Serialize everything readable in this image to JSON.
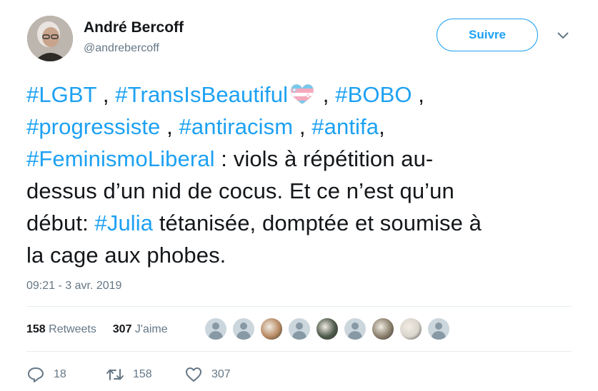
{
  "user": {
    "name": "André Bercoff",
    "handle": "@andrebercoff",
    "follow_label": "Suivre"
  },
  "tweet": {
    "lines": [
      [
        {
          "t": "#LGBT",
          "tag": true
        },
        {
          "t": " , "
        },
        {
          "t": "#TransIsBeautiful",
          "tag": true
        },
        {
          "flag": "transgender-heart-flag"
        },
        {
          "t": " , "
        },
        {
          "t": "#BOBO",
          "tag": true
        },
        {
          "t": " ,"
        }
      ],
      [
        {
          "t": "#progressiste",
          "tag": true
        },
        {
          "t": " , "
        },
        {
          "t": "#antiracism",
          "tag": true
        },
        {
          "t": " , "
        },
        {
          "t": "#antifa",
          "tag": true
        },
        {
          "t": ","
        }
      ],
      [
        {
          "t": "#FeminismoLiberal",
          "tag": true
        },
        {
          "t": " : viols à répétition au-"
        }
      ],
      [
        {
          "t": "dessus d’un nid de cocus. Et ce n’est qu’un"
        }
      ],
      [
        {
          "t": "début: "
        },
        {
          "t": "#Julia",
          "tag": true
        },
        {
          "t": " tétanisée, domptée et soumise à"
        }
      ],
      [
        {
          "t": "la cage aux phobes."
        }
      ]
    ],
    "timestamp": "09:21 - 3 avr. 2019"
  },
  "stats": {
    "retweets_count": "158",
    "retweets_label": "Retweets",
    "likes_count": "307",
    "likes_label": "J'aime"
  },
  "likers": [
    {
      "type": "default"
    },
    {
      "type": "default"
    },
    {
      "type": "photo",
      "color": "#b88a62"
    },
    {
      "type": "default"
    },
    {
      "type": "photo",
      "color": "#4d5a4a"
    },
    {
      "type": "default"
    },
    {
      "type": "photo",
      "color": "#8a7f6b"
    },
    {
      "type": "photo",
      "color": "#d9d4cc"
    },
    {
      "type": "default"
    }
  ],
  "actions": {
    "reply_count": "18",
    "retweet_count": "158",
    "like_count": "307"
  },
  "colors": {
    "accent": "#1da1f2",
    "text": "#14171a",
    "muted": "#657786"
  },
  "icons": {
    "reply": "reply-icon",
    "retweet": "retweet-icon",
    "like": "heart-icon",
    "caret": "chevron-down-icon"
  }
}
